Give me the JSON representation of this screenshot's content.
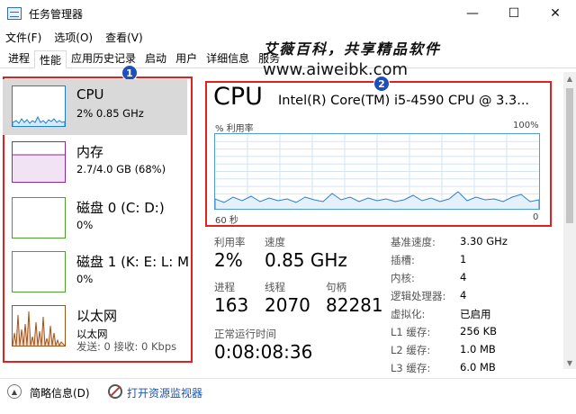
{
  "window": {
    "title": "任务管理器",
    "minimize": "—",
    "maximize": "☐",
    "close": "✕"
  },
  "menu": [
    "文件(F)",
    "选项(O)",
    "查看(V)"
  ],
  "tabs": [
    "进程",
    "性能",
    "应用历史记录",
    "启动",
    "用户",
    "详细信息",
    "服务"
  ],
  "active_tab": 1,
  "watermark": {
    "line1": "艾薇百科，共享精品软件",
    "line2": "www.aiweibk.com"
  },
  "callouts": [
    "1",
    "2"
  ],
  "sidebar": [
    {
      "title": "CPU",
      "sub": "2% 0.85 GHz",
      "sub2": "",
      "color": "#1f7fc8",
      "active": true
    },
    {
      "title": "内存",
      "sub": "2.7/4.0 GB (68%)",
      "sub2": "",
      "color": "#8b2a9e",
      "active": false
    },
    {
      "title": "磁盘 0 (C: D:)",
      "sub": "0%",
      "sub2": "",
      "color": "#4aa32e",
      "active": false
    },
    {
      "title": "磁盘 1 (K: E: L: M",
      "sub": "0%",
      "sub2": "",
      "color": "#4aa32e",
      "active": false
    },
    {
      "title": "以太网",
      "sub": "以太网",
      "sub2": "发送: 0 接收: 0 Kbps",
      "color": "#a3531a",
      "active": false
    }
  ],
  "main": {
    "heading": "CPU",
    "model": "Intel(R) Core(TM) i5-4590 CPU @ 3.3...",
    "graph_ylabel": "% 利用率",
    "graph_ymax": "100%",
    "graph_xlabel": "60 秒",
    "graph_xmin": "0",
    "utilization_label": "利用率",
    "utilization_value": "2%",
    "speed_label": "速度",
    "speed_value": "0.85 GHz",
    "processes_label": "进程",
    "processes_value": "163",
    "threads_label": "线程",
    "threads_value": "2070",
    "handles_label": "句柄",
    "handles_value": "82281",
    "uptime_label": "正常运行时间",
    "uptime_value": "0:08:08:36"
  },
  "specs": [
    {
      "label": "基准速度:",
      "value": "3.30 GHz"
    },
    {
      "label": "插槽:",
      "value": "1"
    },
    {
      "label": "内核:",
      "value": "4"
    },
    {
      "label": "逻辑处理器:",
      "value": "4"
    },
    {
      "label": "虚拟化:",
      "value": "已启用"
    },
    {
      "label": "L1 缓存:",
      "value": "256 KB"
    },
    {
      "label": "L2 缓存:",
      "value": "1.0 MB"
    },
    {
      "label": "L3 缓存:",
      "value": "6.0 MB"
    }
  ],
  "footer": {
    "fewer_details": "简略信息(D)",
    "resource_monitor": "打开资源监视器"
  },
  "colors": {
    "accent_red": "#e0211f",
    "callout_blue": "#1f4fb9",
    "cpu_blue": "#1f7fc8",
    "link_blue": "#1a56b3"
  }
}
